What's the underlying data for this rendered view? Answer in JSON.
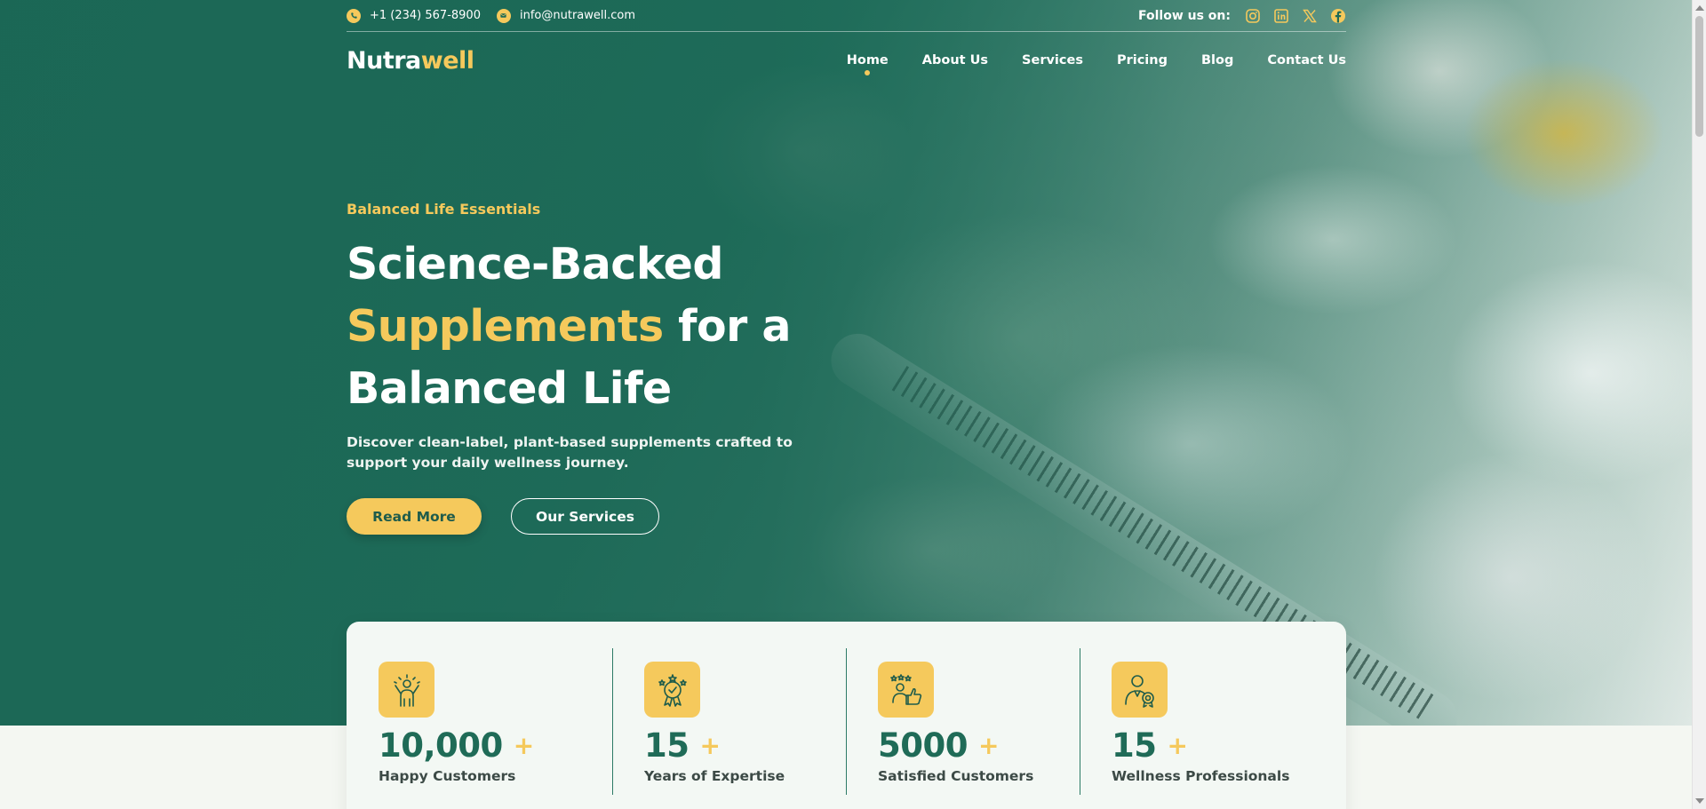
{
  "topbar": {
    "phone": "+1 (234) 567-8900",
    "email": "info@nutrawell.com",
    "follow_label": "Follow us on:",
    "socials": [
      {
        "icon": "instagram-icon"
      },
      {
        "icon": "linkedin-icon"
      },
      {
        "icon": "x-icon"
      },
      {
        "icon": "facebook-icon"
      }
    ]
  },
  "brand": {
    "logo_part1": "Nutra",
    "logo_part2": "well"
  },
  "nav": {
    "items": [
      {
        "label": "Home",
        "active": true
      },
      {
        "label": "About Us"
      },
      {
        "label": "Services"
      },
      {
        "label": "Pricing"
      },
      {
        "label": "Blog"
      },
      {
        "label": "Contact Us"
      }
    ]
  },
  "hero": {
    "eyebrow": "Balanced Life Essentials",
    "headline_line1": "Science-Backed",
    "headline_accent": "Supplements",
    "headline_line2_rest": " for a",
    "headline_line3": "Balanced Life",
    "subtext": "Discover clean-label, plant-based supplements crafted to support your daily wellness journey.",
    "primary_button": "Read More",
    "secondary_button": "Our Services"
  },
  "stats": [
    {
      "value": "10,000",
      "plus": "+",
      "label": "Happy Customers",
      "icon": "celebrating-person-icon"
    },
    {
      "value": "15",
      "plus": "+",
      "label": "Years of Expertise",
      "icon": "award-medal-icon"
    },
    {
      "value": "5000",
      "plus": "+",
      "label": "Satisfied Customers",
      "icon": "thumbs-up-rating-icon"
    },
    {
      "value": "15",
      "plus": "+",
      "label": "Wellness Professionals",
      "icon": "professional-badge-icon"
    }
  ],
  "colors": {
    "primary_green": "#1f6b57",
    "accent_yellow": "#f5c95c",
    "card_background": "#f3f8f4"
  }
}
